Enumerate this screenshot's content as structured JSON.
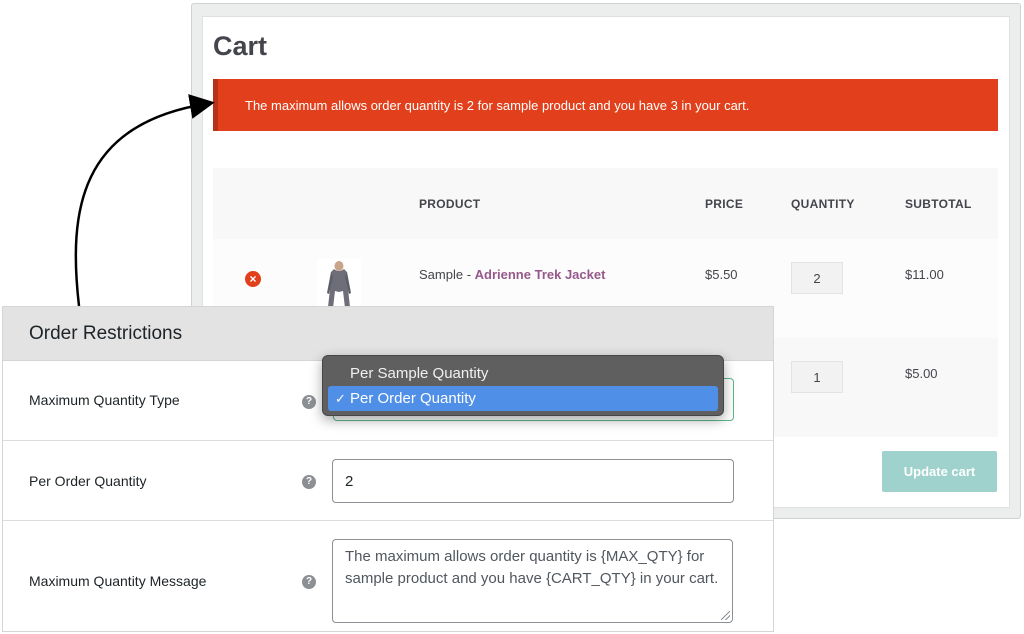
{
  "cart": {
    "title": "Cart",
    "error_message": "The maximum allows order quantity is 2 for sample product and you have 3 in your cart.",
    "columns": {
      "product": "PRODUCT",
      "price": "PRICE",
      "quantity": "QUANTITY",
      "subtotal": "SUBTOTAL"
    },
    "rows": [
      {
        "prefix": "Sample - ",
        "product": "Adrienne Trek Jacket",
        "price": "$5.50",
        "quantity": "2",
        "subtotal": "$11.00"
      },
      {
        "quantity": "1",
        "subtotal": "$5.00"
      }
    ],
    "update_button": "Update cart",
    "remove_icon": "×",
    "accent_color": "#e2401c",
    "link_color": "#96588a",
    "button_color": "#9fd2cd"
  },
  "panel": {
    "title": "Order Restrictions",
    "fields": {
      "type_label": "Maximum Quantity Type",
      "order_qty_label": "Per Order Quantity",
      "order_qty_value": "2",
      "message_label": "Maximum Quantity Message",
      "message_value": "The maximum allows order quantity is {MAX_QTY} for sample product and you have {CART_QTY} in your cart."
    },
    "help_icon": "?"
  },
  "dropdown": {
    "options": [
      "Per Sample Quantity",
      "Per Order Quantity"
    ],
    "selected": "Per Order Quantity",
    "check": "✓",
    "highlight_color": "#4f8fe8"
  }
}
